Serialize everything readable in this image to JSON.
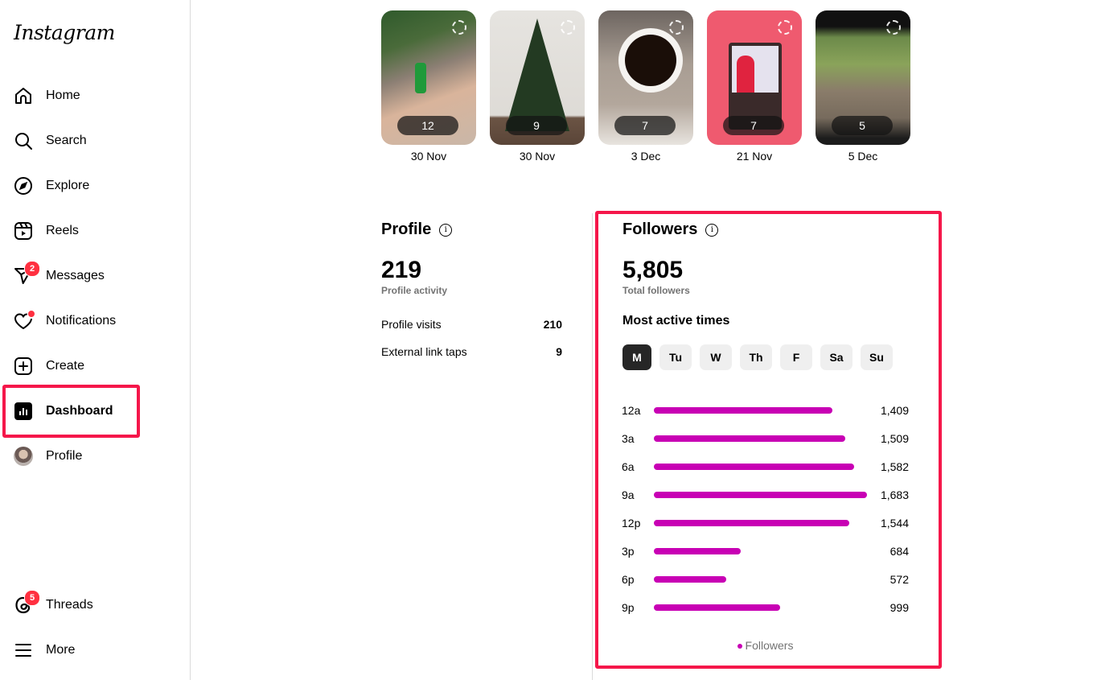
{
  "app": {
    "logo": "Instagram"
  },
  "sidebar": {
    "items": [
      {
        "label": "Home",
        "icon": "home-icon"
      },
      {
        "label": "Search",
        "icon": "search-icon"
      },
      {
        "label": "Explore",
        "icon": "compass-icon"
      },
      {
        "label": "Reels",
        "icon": "reels-icon"
      },
      {
        "label": "Messages",
        "icon": "messenger-icon",
        "badge": "2"
      },
      {
        "label": "Notifications",
        "icon": "heart-icon",
        "dot": true
      },
      {
        "label": "Create",
        "icon": "plus-square-icon"
      },
      {
        "label": "Dashboard",
        "icon": "dashboard-icon",
        "active": true
      },
      {
        "label": "Profile",
        "icon": "avatar"
      }
    ],
    "bottom_items": [
      {
        "label": "Threads",
        "icon": "threads-icon",
        "badge": "5"
      },
      {
        "label": "More",
        "icon": "menu-icon"
      }
    ]
  },
  "stories": [
    {
      "count": "12",
      "date": "30 Nov"
    },
    {
      "count": "9",
      "date": "30 Nov"
    },
    {
      "count": "7",
      "date": "3 Dec"
    },
    {
      "count": "7",
      "date": "21 Nov"
    },
    {
      "count": "5",
      "date": "5 Dec"
    }
  ],
  "profile_card": {
    "title": "Profile",
    "value": "219",
    "value_label": "Profile activity",
    "rows": [
      {
        "label": "Profile visits",
        "value": "210"
      },
      {
        "label": "External link taps",
        "value": "9"
      }
    ]
  },
  "followers_card": {
    "title": "Followers",
    "value": "5,805",
    "value_label": "Total followers",
    "section_title": "Most active times",
    "days": [
      "M",
      "Tu",
      "W",
      "Th",
      "F",
      "Sa",
      "Su"
    ],
    "selected_day": "M",
    "bar_color": "#c800b4"
  },
  "chart_data": {
    "type": "bar",
    "orientation": "horizontal",
    "title": "Most active times",
    "categories": [
      "12a",
      "3a",
      "6a",
      "9a",
      "12p",
      "3p",
      "6p",
      "9p"
    ],
    "series": [
      {
        "name": "Followers",
        "values": [
          1409,
          1509,
          1582,
          1683,
          1544,
          684,
          572,
          999
        ]
      }
    ],
    "value_labels": [
      "1,409",
      "1,509",
      "1,582",
      "1,683",
      "1,544",
      "684",
      "572",
      "999"
    ],
    "legend": "bottom-center",
    "grid": false
  },
  "colors": {
    "accent": "#c800b4",
    "highlight": "#f5174a",
    "badge": "#ff3040"
  }
}
